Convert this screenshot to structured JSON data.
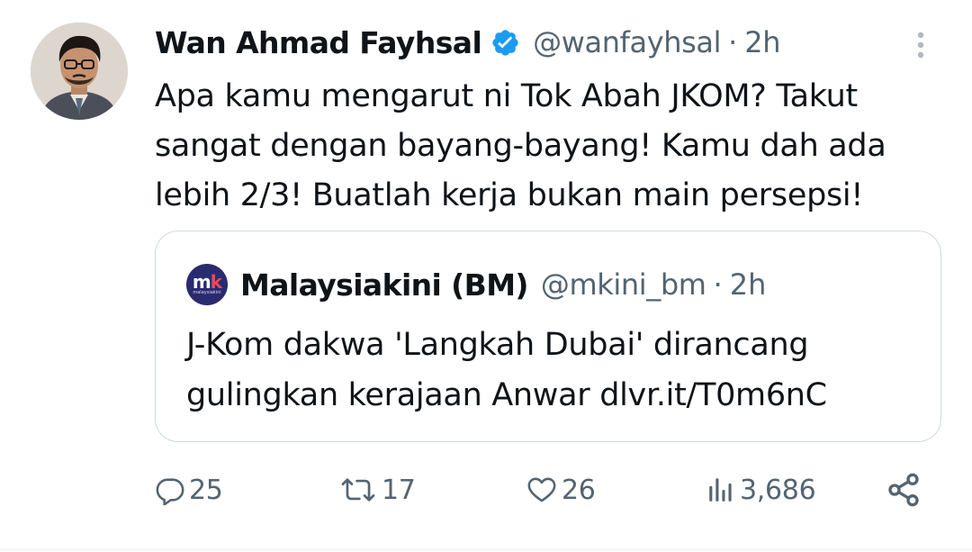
{
  "tweet": {
    "author_name": "Wan Ahmad Fayhsal",
    "handle": "@wanfayhsal",
    "separator": "·",
    "time": "2h",
    "text": "Apa kamu mengarut ni Tok Abah JKOM? Takut\nsangat dengan bayang-bayang! Kamu dah ada\nlebih 2/3! Buatlah kerja bukan main persepsi!",
    "verified": true,
    "icons": {
      "avatar": "author-avatar",
      "verified": "verified-badge-icon",
      "more": "more-options-icon"
    }
  },
  "quote": {
    "avatar_text": "mk",
    "avatar_m": "m",
    "avatar_k": "k",
    "avatar_subtext": "malaysiakini",
    "author_name": "Malaysiakini (BM)",
    "handle": "@mkini_bm",
    "separator": "·",
    "time": "2h",
    "text": "J-Kom dakwa 'Langkah Dubai' dirancang\ngulingkan kerajaan Anwar dlvr.it/T0m6nC"
  },
  "actions": {
    "reply_count": "25",
    "retweet_count": "17",
    "like_count": "26",
    "views_count": "3,686"
  },
  "colors": {
    "text_primary": "#0f1419",
    "text_secondary": "#536471",
    "verified_blue": "#1d9bf0",
    "border": "#cfd9de",
    "malaysiakini_navy": "#2a2a6e",
    "malaysiakini_red": "#e44b5c"
  }
}
